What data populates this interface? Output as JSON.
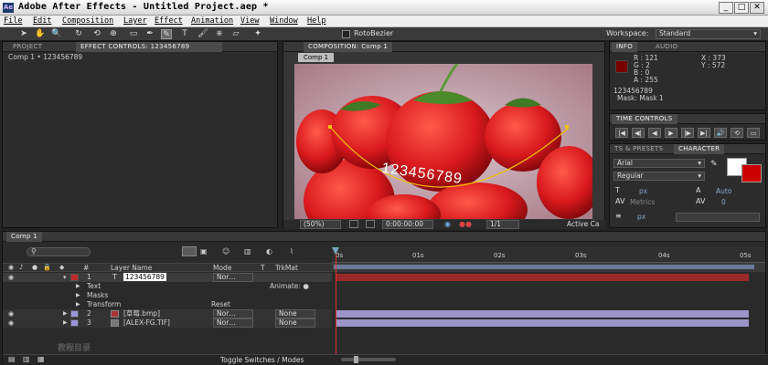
{
  "window": {
    "app_icon": "Ae",
    "title": "Adobe After Effects - Untitled Project.aep *",
    "min": "_",
    "max": "□",
    "close": "✕"
  },
  "menu": [
    "File",
    "Edit",
    "Composition",
    "Layer",
    "Effect",
    "Animation",
    "View",
    "Window",
    "Help"
  ],
  "toolbar": {
    "rotobezier_label": "RotoBezier",
    "workspace_label": "Workspace:",
    "workspace_value": "Standard"
  },
  "project_panel": {
    "tab_project": "PROJECT",
    "tab_effect_controls": "EFFECT CONTROLS: 123456789",
    "breadcrumb": "Comp 1 • 123456789"
  },
  "composition_panel": {
    "tab": "COMPOSITION: Comp 1",
    "comp_tab": "Comp 1",
    "overlay_text": "123456789",
    "zoom": "(50%)",
    "timecode": "0:00:00:00",
    "resolution": "1/1",
    "active_camera": "Active Ca"
  },
  "info_panel": {
    "tab_info": "INFO",
    "tab_audio": "AUDIO",
    "r": "R : 121",
    "g": "G : 2",
    "b": "B : 0",
    "a": "A : 255",
    "x": "X : 373",
    "y": "Y : 572",
    "layer_name": "123456789",
    "mask": "Mask: Mask 1",
    "swatch_color": "#7a0000"
  },
  "time_controls": {
    "tab": "TIME CONTROLS",
    "buttons": [
      "|◀",
      "◀|",
      "◀",
      "▶",
      "|▶",
      "▶|",
      "🔊",
      "⟲",
      "▭"
    ]
  },
  "character_panel": {
    "tab_effects": "TS & PRESETS",
    "tab_character": "CHARACTER",
    "font": "Arial",
    "style": "Regular",
    "font_size": "px",
    "leading": "Auto",
    "kerning": "Metrics",
    "tracking": "0",
    "stroke_width": "px"
  },
  "timeline": {
    "tab": "Comp 1",
    "headers": {
      "num": "#",
      "layer_name": "Layer Name",
      "mode": "Mode",
      "t": "T",
      "trkmat": "TrkMat"
    },
    "rulers": [
      "0s",
      "01s",
      "02s",
      "03s",
      "04s",
      "05s"
    ],
    "layers": [
      {
        "num": "1",
        "name": "123456789",
        "mode": "Nor…",
        "trkmat": "",
        "label_color": "#c02a2a",
        "icon": "T"
      },
      {
        "num": "",
        "name": "Text",
        "mode": "",
        "extra": "Animate: ●"
      },
      {
        "num": "",
        "name": "Masks"
      },
      {
        "num": "",
        "name": "Transform",
        "extra": "Reset"
      },
      {
        "num": "2",
        "name": "[草莓.bmp]",
        "mode": "Nor…",
        "trkmat": "None",
        "label_color": "#9a94d8",
        "icon": "img"
      },
      {
        "num": "3",
        "name": "[ALEX-FG.TIF]",
        "mode": "Nor…",
        "trkmat": "None",
        "label_color": "#9a94d8",
        "icon": "img"
      }
    ],
    "toggle_label": "Toggle Switches / Modes",
    "watermark": "教程目录"
  },
  "colors": {
    "accent_yellow": "#f0c000",
    "layer_red": "#9a2a2a",
    "layer_purple": "#9a94c8"
  }
}
